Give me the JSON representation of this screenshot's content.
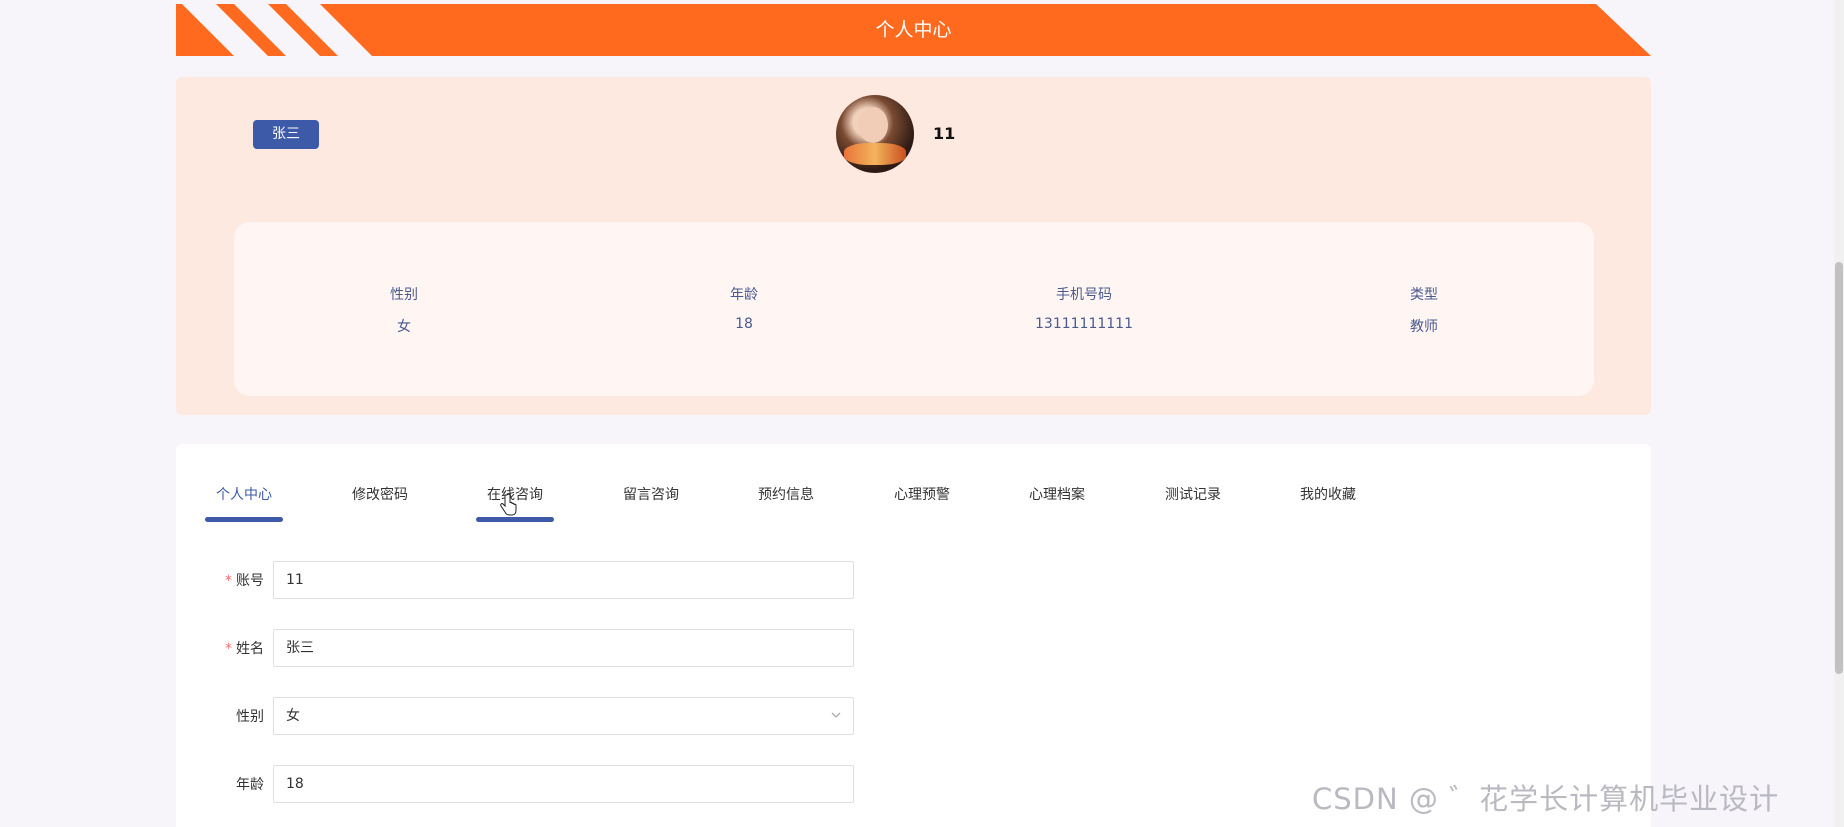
{
  "header": {
    "title": "个人中心"
  },
  "profile": {
    "name_badge": "张三",
    "username": "11",
    "info": [
      {
        "label": "性别",
        "value": "女"
      },
      {
        "label": "年龄",
        "value": "18"
      },
      {
        "label": "手机号码",
        "value": "13111111111"
      },
      {
        "label": "类型",
        "value": "教师"
      }
    ]
  },
  "tabs": [
    {
      "label": "个人中心",
      "active": true
    },
    {
      "label": "修改密码",
      "active": false
    },
    {
      "label": "在线咨询",
      "active": false
    },
    {
      "label": "留言咨询",
      "active": false
    },
    {
      "label": "预约信息",
      "active": false
    },
    {
      "label": "心理预警",
      "active": false
    },
    {
      "label": "心理档案",
      "active": false
    },
    {
      "label": "测试记录",
      "active": false
    },
    {
      "label": "我的收藏",
      "active": false
    }
  ],
  "form": {
    "account": {
      "label": "账号",
      "value": "11",
      "required": "*"
    },
    "name": {
      "label": "姓名",
      "value": "张三",
      "required": "*"
    },
    "gender": {
      "label": "性别",
      "value": "女"
    },
    "age": {
      "label": "年龄",
      "value": "18"
    }
  },
  "watermark": "CSDN @ ゛花学长计算机毕业设计",
  "colors": {
    "accent": "#ff6a1f",
    "primary": "#3d5aa8",
    "card": "#fde9e0"
  }
}
